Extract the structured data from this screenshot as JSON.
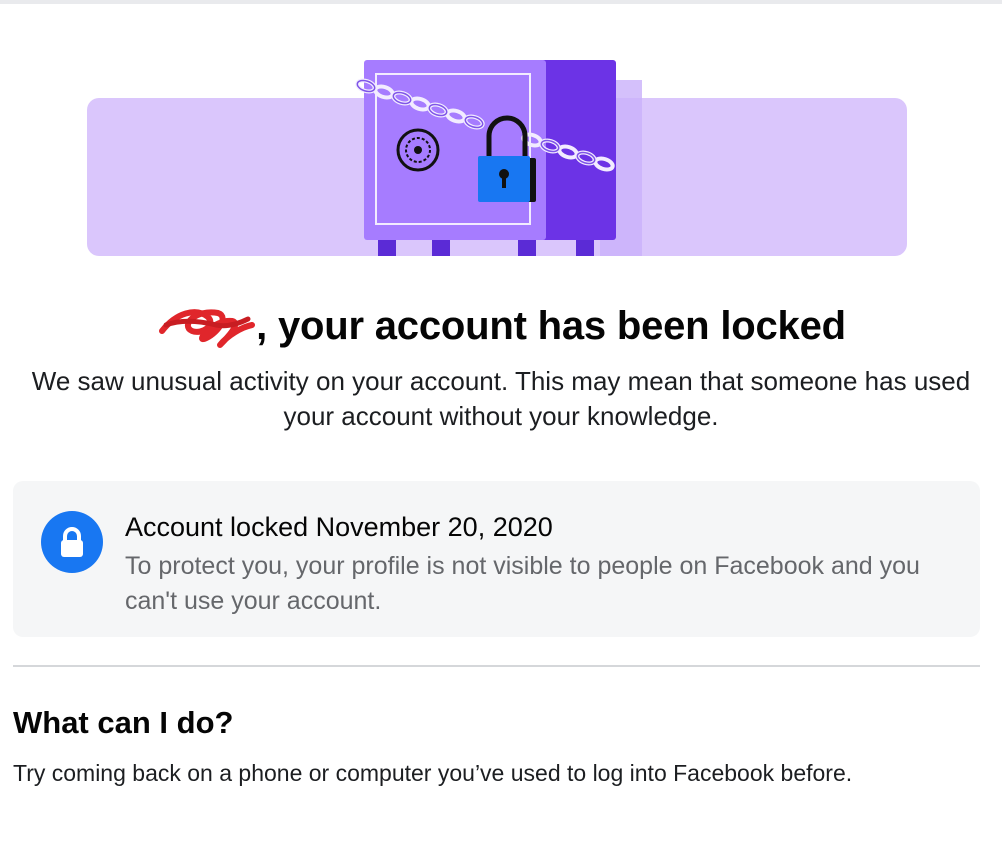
{
  "colors": {
    "accent": "#1877f2",
    "hero_band": "#dac6fc",
    "safe_body": "#a67cff",
    "safe_side": "#6c33e6",
    "redaction_mark": "#e0262b",
    "card_background": "#f5f6f7",
    "secondary_text": "#65676b"
  },
  "hero": {
    "illustration": "locked-safe-with-chain-and-padlock"
  },
  "headline": {
    "greeting_redacted": true,
    "text": "your account has been locked"
  },
  "intro": {
    "text": "We saw unusual activity on your account. This may mean that someone has used your account without your knowledge."
  },
  "notice": {
    "icon": "lock-icon",
    "title": "Account locked November 20, 2020",
    "body": "To protect you, your profile is not visible to people on Facebook and you can't use your account."
  },
  "help": {
    "title": "What can I do?",
    "body": "Try coming back on a phone or computer you’ve used to log into Facebook before."
  }
}
